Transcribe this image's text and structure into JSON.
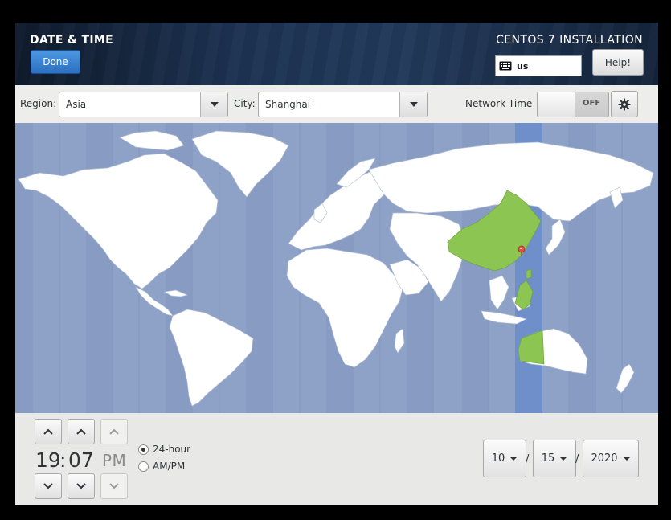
{
  "header": {
    "spoke_title": "DATE & TIME",
    "done_label": "Done",
    "product_title": "CENTOS 7 INSTALLATION",
    "keyboard_layout": "us",
    "help_label": "Help!"
  },
  "toolbar": {
    "region_label": "Region:",
    "region_value": "Asia",
    "city_label": "City:",
    "city_value": "Shanghai",
    "network_time_label": "Network Time",
    "network_time_state": "OFF"
  },
  "map": {
    "selected_region": "Asia/Shanghai",
    "colors": {
      "ocean": "#8ea2c8",
      "land": "#ffffff",
      "selected_country": "#8dc553",
      "selected_timezone_band": "#6e8fc9",
      "pin": "#e35045"
    }
  },
  "time": {
    "hours": "19",
    "minutes": "07",
    "ampm": "PM",
    "format_24h_label": "24-hour",
    "format_ampm_label": "AM/PM",
    "selected_format": "24-hour"
  },
  "date": {
    "month": "10",
    "day": "15",
    "year": "2020",
    "separator": "/"
  }
}
